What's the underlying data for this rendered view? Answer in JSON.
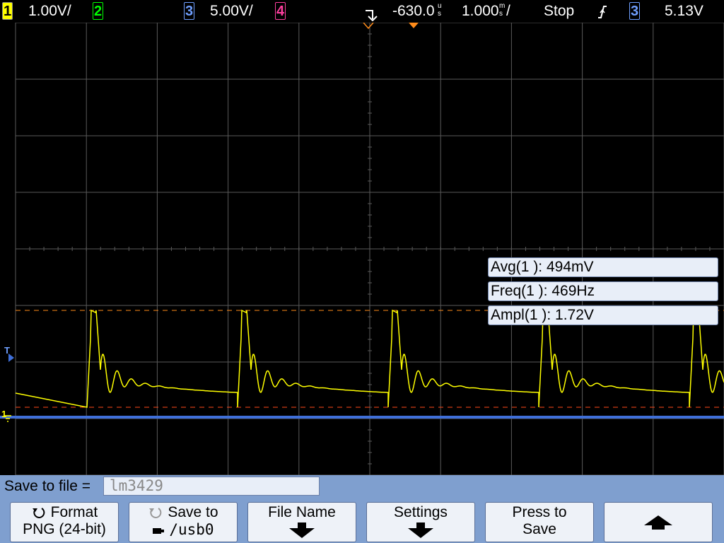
{
  "topbar": {
    "ch1_num": "1",
    "ch1_scale": "1.00V/",
    "ch2_num": "2",
    "ch3_num": "3",
    "ch3_scale": "5.00V/",
    "ch4_num": "4",
    "time_delay": "-630.0",
    "delay_unit_top": "u",
    "delay_unit_bottom": "s",
    "time_scale": "1.000",
    "scale_unit_top": "m",
    "scale_unit_bottom": "s",
    "scale_suffix": "/",
    "run_state": "Stop",
    "trigger_slope_icon": "rising-edge-icon",
    "trigger_source": "3",
    "trigger_level": "5.13V"
  },
  "markers": {
    "ch1_ground": "1",
    "trigger_marker": "T"
  },
  "measurements": [
    {
      "label": "Avg(1 ): 494mV"
    },
    {
      "label": "Freq(1 ): 469Hz"
    },
    {
      "label": "Ampl(1 ): 1.72V"
    }
  ],
  "save": {
    "label": "Save to file =",
    "filename": "lm3429"
  },
  "softkeys": {
    "format_l1": "Format",
    "format_l2": "PNG (24-bit)",
    "saveto_l1": "Save to",
    "saveto_l2": "/usb0",
    "filename_l1": "File Name",
    "settings_l1": "Settings",
    "press_l1": "Press to",
    "press_l2": "Save"
  },
  "colors": {
    "ch1": "#ffff00",
    "ch2": "#00ff00",
    "ch3": "#3f6fd8",
    "ch4": "#ff3f9f",
    "grid": "#5a5a5a",
    "cursor": "#ff8c1a"
  }
}
